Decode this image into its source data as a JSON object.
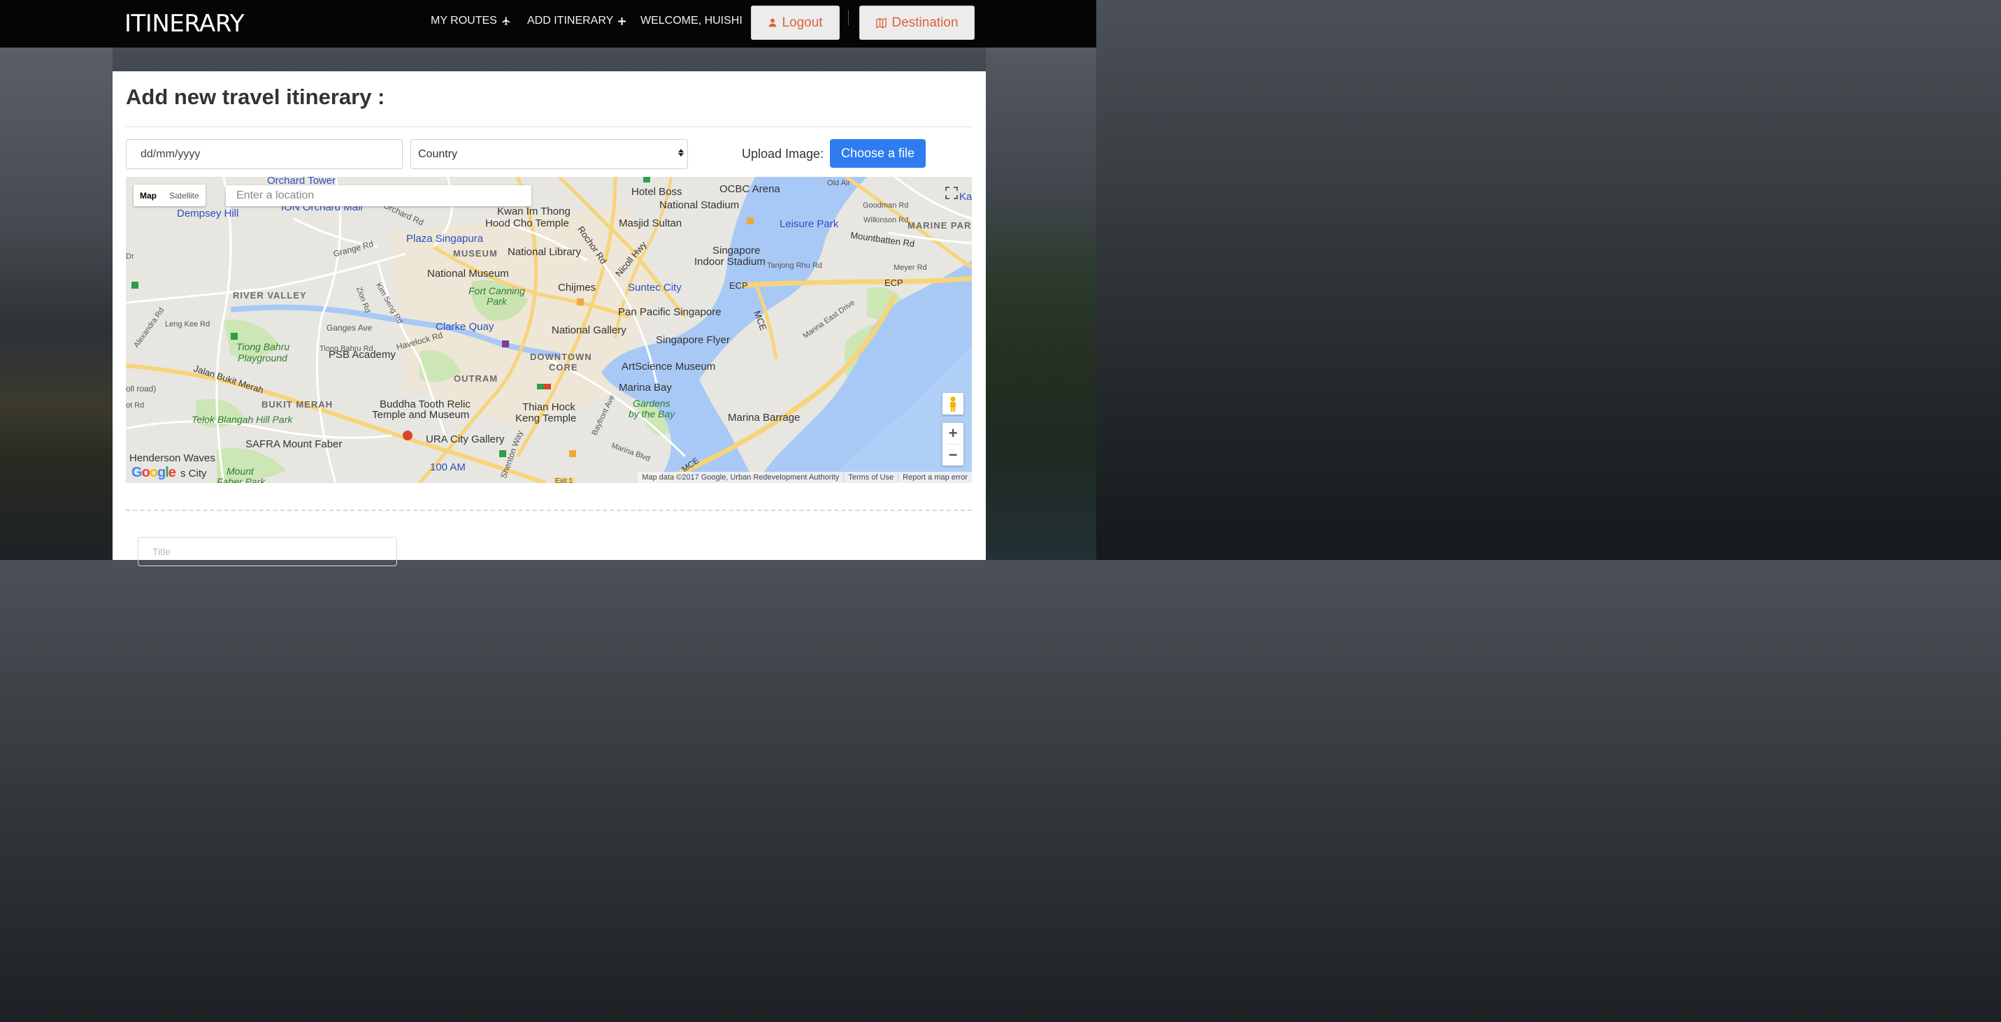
{
  "brand": "ITINERARY",
  "nav": {
    "my_routes": "MY ROUTES",
    "add_itinerary": "ADD ITINERARY",
    "welcome": "WELCOME, HUISHI",
    "logout": "Logout",
    "destination": "Destination"
  },
  "form": {
    "title": "Add new travel itinerary :",
    "date_placeholder": "dd/mm/yyyy",
    "country_selected": "Country",
    "upload_label": "Upload Image:",
    "choose_file": "Choose a file",
    "title_placeholder": "Title"
  },
  "map": {
    "toggle_map": "Map",
    "toggle_satellite": "Satellite",
    "location_placeholder": "Enter a location",
    "logo": "Google",
    "attribution": "Map data ©2017 Google, Urban Redevelopment Authority",
    "terms": "Terms of Use",
    "report": "Report a map error",
    "zoom_in": "+",
    "zoom_out": "−",
    "labels": {
      "orchard_tower": "Orchard Tower",
      "ion_orchard": "ION Orchard Mall",
      "dempsey": "Dempsey Hill",
      "kwan_im": "Kwan Im Thong",
      "hood_cho": "Hood Cho Temple",
      "plaza_sg": "Plaza Singapura",
      "museum": "MUSEUM",
      "national_library": "National Library",
      "national_museum": "National Museum",
      "fort_canning": "Fort Canning",
      "park": "Park",
      "river_valley": "RIVER VALLEY",
      "clarke_quay": "Clarke Quay",
      "tiong_bahru_pg": "Tiong Bahru",
      "playground": "Playground",
      "psb": "PSB Academy",
      "downtown": "DOWNTOWN",
      "core": "CORE",
      "outram": "OUTRAM",
      "bukit_merah": "BUKIT MERAH",
      "buddha_tooth": "Buddha Tooth Relic",
      "temple_museum": "Temple and Museum",
      "thian_hock": "Thian Hock",
      "keng_temple": "Keng Temple",
      "ura": "URA City Gallery",
      "telok_blangah": "Telok Blangah Hill Park",
      "safra": "SAFRA Mount Faber",
      "henderson": "Henderson Waves",
      "s_city": "s City",
      "mount": "Mount",
      "faber_park": "Faber Park",
      "hundred_am": "100 AM",
      "chijmes": "Chijmes",
      "national_gallery": "National Gallery",
      "suntec": "Suntec City",
      "pan_pacific": "Pan Pacific Singapore",
      "singapore_flyer": "Singapore Flyer",
      "artscience": "ArtScience Museum",
      "marina_bay": "Marina Bay",
      "gardens": "Gardens",
      "by_the_bay": "by the Bay",
      "marina_barrage": "Marina Barrage",
      "hotel_boss": "Hotel Boss",
      "ocbc": "OCBC Arena",
      "national_stadium": "National Stadium",
      "masjid": "Masjid Sultan",
      "leisure_park": "Leisure Park",
      "marine_parade": "MARINE PAR",
      "sg_indoor": "Singapore",
      "indoor_stadium": "Indoor Stadium",
      "kallang": "Ka",
      "goodman_rd": "Goodman Rd",
      "wilkinson_rd": "Wilkinson Rd",
      "mountbatten": "Mountbatten Rd",
      "tanjong_rhu": "Tanjong Rhu Rd",
      "meyer_rd": "Meyer Rd",
      "ecp1": "ECP",
      "ecp2": "ECP",
      "mce": "MCE",
      "mce2": "MCE",
      "marina_east": "Marina East Drive",
      "bayfront": "Bayfront Ave",
      "marina_blvd": "Marina Blvd",
      "shenton": "Shenton Way",
      "grange_rd": "Grange Rd",
      "orchard_rd": "Orchard Rd",
      "leng_kee": "Leng Kee Rd",
      "alexandra": "Alexandra Rd",
      "ganges": "Ganges Ave",
      "havelock": "Havelock Rd",
      "tiong_bahru_rd": "Tiong Bahru Rd",
      "jalan_bukit_merah": "Jalan Bukit Merah",
      "kim_seng": "Kim Seng Rd",
      "zion_rd": "Zion Rd",
      "rochor": "Rochor Rd",
      "nicoll": "Nicoll Hwy",
      "old_air": "Old Air",
      "oll_road": "oll road)",
      "ot_rd": "ot Rd",
      "dr": "Dr",
      "exit1": "Exit 1"
    }
  }
}
